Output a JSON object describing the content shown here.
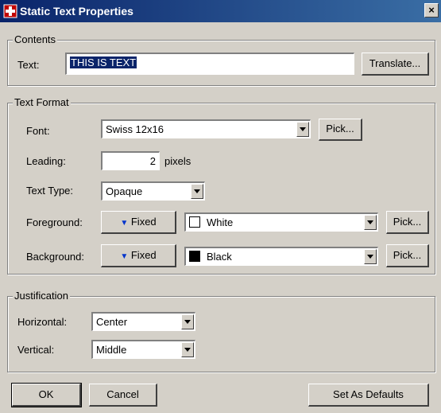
{
  "window": {
    "title": "Static Text Properties",
    "close_label": "×"
  },
  "contents": {
    "group_label": "Contents",
    "text_label": "Text:",
    "text_value": "THIS IS TEXT",
    "translate_label": "Translate..."
  },
  "text_format": {
    "group_label": "Text Format",
    "font_label": "Font:",
    "font_value": "Swiss 12x16",
    "font_pick_label": "Pick...",
    "leading_label": "Leading:",
    "leading_value": "2",
    "leading_unit": "pixels",
    "text_type_label": "Text Type:",
    "text_type_value": "Opaque",
    "foreground_label": "Foreground:",
    "foreground_mode": "Fixed",
    "foreground_color_name": "White",
    "foreground_color": "#ffffff",
    "foreground_pick_label": "Pick...",
    "background_label": "Background:",
    "background_mode": "Fixed",
    "background_color_name": "Black",
    "background_color": "#000000",
    "background_pick_label": "Pick..."
  },
  "justification": {
    "group_label": "Justification",
    "horizontal_label": "Horizontal:",
    "horizontal_value": "Center",
    "vertical_label": "Vertical:",
    "vertical_value": "Middle"
  },
  "footer": {
    "ok_label": "OK",
    "cancel_label": "Cancel",
    "defaults_label": "Set As Defaults"
  },
  "colors": {
    "title_bar": "#0a246a",
    "dialog_bg": "#d4d0c8",
    "accent_triangle": "#0033cc"
  }
}
